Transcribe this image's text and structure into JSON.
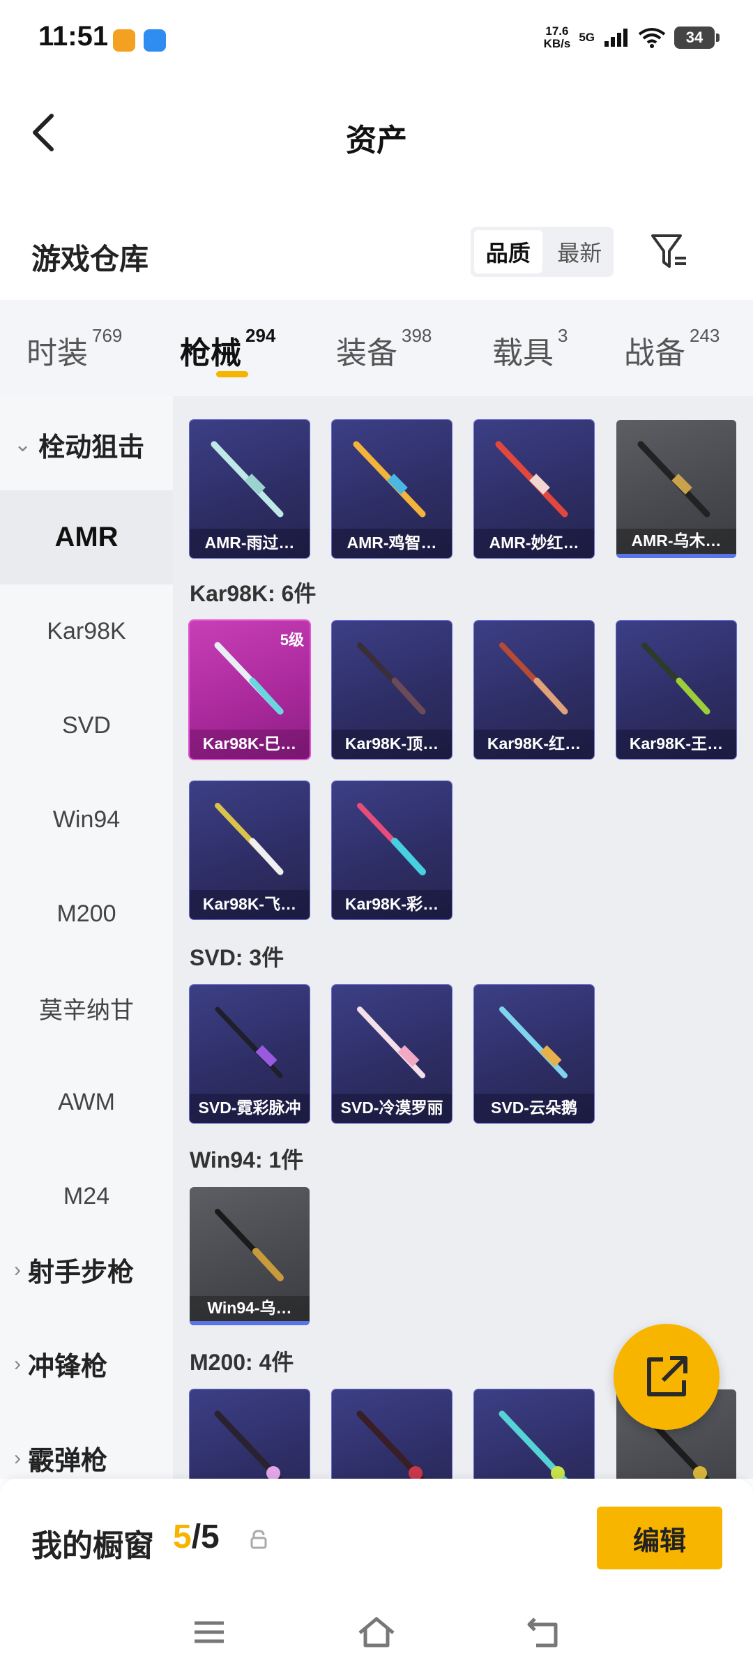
{
  "status_bar": {
    "time": "11:51",
    "speed_value": "17.6",
    "speed_unit": "KB/s",
    "network": "5G",
    "battery": "34"
  },
  "header": {
    "title": "资产"
  },
  "warehouse": {
    "title": "游戏仓库",
    "sort_options": [
      "品质",
      "最新"
    ],
    "selected_sort": "品质"
  },
  "tabs": [
    {
      "label": "时装",
      "count": "769"
    },
    {
      "label": "枪械",
      "count": "294"
    },
    {
      "label": "装备",
      "count": "398"
    },
    {
      "label": "载具",
      "count": "3"
    },
    {
      "label": "战备",
      "count": "243"
    }
  ],
  "active_tab": "枪械",
  "sidebar": {
    "group1": "栓动狙击",
    "items": [
      "AMR",
      "Kar98K",
      "SVD",
      "Win94",
      "M200",
      "莫辛纳甘",
      "AWM",
      "M24"
    ],
    "active": "AMR",
    "group2": "射手步枪",
    "group3": "冲锋枪",
    "group4": "霰弹枪"
  },
  "content": {
    "groups": [
      {
        "title": "Kar98K: 6件"
      },
      {
        "title": "SVD: 3件"
      },
      {
        "title": "Win94: 1件"
      },
      {
        "title": "M200: 4件"
      }
    ],
    "amr_cards": [
      "AMR-雨过…",
      "AMR-鸡智…",
      "AMR-妙红…",
      "AMR-乌木…"
    ],
    "kar_cards": [
      "Kar98K-巳…",
      "Kar98K-顶…",
      "Kar98K-红…",
      "Kar98K-王…",
      "Kar98K-飞…",
      "Kar98K-彩…"
    ],
    "kar_level": "5级",
    "svd_cards": [
      "SVD-霓彩脉冲",
      "SVD-冷漠罗丽",
      "SVD-云朵鹅"
    ],
    "win_cards": [
      "Win94-乌…"
    ]
  },
  "showcase": {
    "label": "我的橱窗",
    "current": "5",
    "total": "/5",
    "edit": "编辑"
  },
  "colors": {
    "accent": "#f7b500",
    "card_purple": "#2e2e66",
    "card_pink": "#b02fa2",
    "card_grey": "#4b4c51"
  }
}
